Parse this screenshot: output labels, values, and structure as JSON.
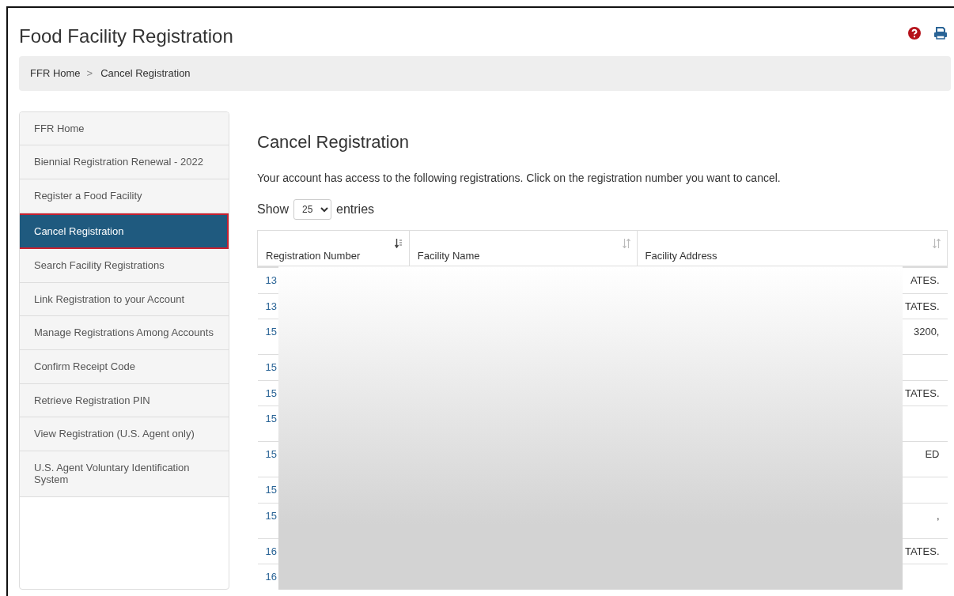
{
  "header": {
    "title": "Food Facility Registration"
  },
  "breadcrumb": [
    {
      "label": "FFR Home"
    },
    {
      "label": ">"
    },
    {
      "label": "Cancel Registration"
    }
  ],
  "sidebar": {
    "items": [
      {
        "label": "FFR Home",
        "selected": false
      },
      {
        "label": "Biennial Registration Renewal - 2022",
        "selected": false
      },
      {
        "label": "Register a Food Facility",
        "selected": false
      },
      {
        "label": "Cancel Registration",
        "selected": true
      },
      {
        "label": "Search Facility Registrations",
        "selected": false
      },
      {
        "label": "Link Registration to your Account",
        "selected": false
      },
      {
        "label": "Manage Registrations Among Accounts",
        "selected": false
      },
      {
        "label": "Confirm Receipt Code",
        "selected": false
      },
      {
        "label": "Retrieve Registration PIN",
        "selected": false
      },
      {
        "label": "View Registration (U.S. Agent only)",
        "selected": false
      },
      {
        "label": "U.S. Agent Voluntary Identification System",
        "selected": false
      }
    ]
  },
  "main": {
    "heading": "Cancel Registration",
    "intro": "Your account has access to the following registrations. Click on the registration number you want to cancel.",
    "length_menu": {
      "before": "Show",
      "value": "25",
      "after": "entries"
    }
  },
  "table": {
    "columns": [
      {
        "label": "Registration Number",
        "sorted": true
      },
      {
        "label": "Facility Name",
        "sorted": false
      },
      {
        "label": "Facility Address",
        "sorted": false
      }
    ],
    "rows": [
      {
        "column_1": "13",
        "column_3": "ATES."
      },
      {
        "column_1": "13",
        "column_3": "TATES."
      },
      {
        "column_1": "15",
        "column_3": "3200,"
      },
      {
        "column_1": "15"
      },
      {
        "column_1": "15",
        "column_3": "TATES."
      },
      {
        "column_1": "15"
      },
      {
        "column_1": "15",
        "column_3": "ED"
      },
      {
        "column_1": "15"
      },
      {
        "column_1": "15",
        "column_3": ","
      },
      {
        "column_1": "16",
        "column_3": "TATES."
      },
      {
        "column_1": "16"
      }
    ]
  }
}
